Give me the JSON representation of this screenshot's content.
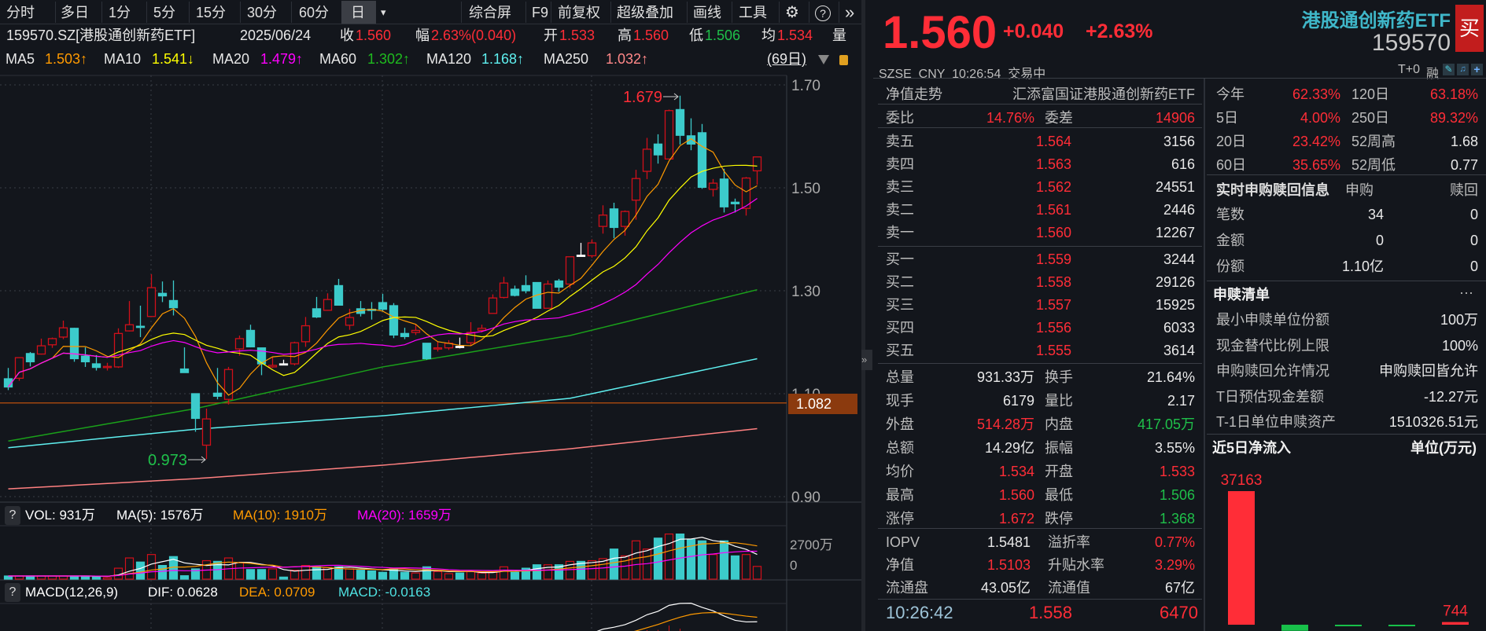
{
  "toolbar": {
    "periods": [
      "分时",
      "多日",
      "1分",
      "5分",
      "15分",
      "30分",
      "60分",
      "日"
    ],
    "dropdown": "▾",
    "tools": [
      "综合屏",
      "F9",
      "前复权",
      "超级叠加",
      "画线",
      "工具"
    ],
    "gear": "⚙",
    "help": "?",
    "expand": "»"
  },
  "info": {
    "code_name": "159570.SZ[港股通创新药ETF]",
    "date": "2025/06/24",
    "close_label": "收",
    "close": "1.560",
    "chg_label": "幅",
    "chg": "2.63%(0.040)",
    "open_label": "开",
    "open": "1.533",
    "high_label": "高",
    "high": "1.560",
    "low_label": "低",
    "low": "1.506",
    "avg_label": "均",
    "avg": "1.534",
    "vol_label": "量"
  },
  "ma": {
    "ma5_label": "MA5",
    "ma5": "1.503↑",
    "ma10_label": "MA10",
    "ma10": "1.541↓",
    "ma20_label": "MA20",
    "ma20": "1.479↑",
    "ma60_label": "MA60",
    "ma60": "1.302↑",
    "ma120_label": "MA120",
    "ma120": "1.168↑",
    "ma250_label": "MA250",
    "ma250": "1.032↑",
    "range": "(69日)"
  },
  "vol_panel": {
    "help": "?",
    "vol": "VOL: 931万",
    "ma5": "MA(5): 1576万",
    "ma10": "MA(10): 1910万",
    "ma20": "MA(20): 1659万",
    "axis_top": "2700万",
    "axis_zero": "0"
  },
  "macd_panel": {
    "help": "?",
    "title": "MACD(12,26,9)",
    "dif": "DIF: 0.0628",
    "dea": "DEA: 0.0709",
    "macd": "MACD: -0.0163"
  },
  "quote": {
    "price": "1.560",
    "change": "+0.040",
    "pct": "+2.63%",
    "name": "港股通创新药ETF",
    "code": "159570",
    "buy": "买",
    "status": "SZSE  CNY  10:26:54  交易中",
    "t0": "T+0",
    "margin": "融"
  },
  "nav": {
    "label": "净值走势",
    "fund": "汇添富国证港股通创新药ETF"
  },
  "commit": {
    "ratio_label": "委比",
    "ratio": "14.76%",
    "diff_label": "委差",
    "diff": "14906"
  },
  "asks": [
    {
      "label": "卖五",
      "price": "1.564",
      "vol": "3156"
    },
    {
      "label": "卖四",
      "price": "1.563",
      "vol": "616"
    },
    {
      "label": "卖三",
      "price": "1.562",
      "vol": "24551"
    },
    {
      "label": "卖二",
      "price": "1.561",
      "vol": "2446"
    },
    {
      "label": "卖一",
      "price": "1.560",
      "vol": "12267"
    }
  ],
  "bids": [
    {
      "label": "买一",
      "price": "1.559",
      "vol": "3244"
    },
    {
      "label": "买二",
      "price": "1.558",
      "vol": "29126"
    },
    {
      "label": "买三",
      "price": "1.557",
      "vol": "15925"
    },
    {
      "label": "买四",
      "price": "1.556",
      "vol": "6033"
    },
    {
      "label": "买五",
      "price": "1.555",
      "vol": "3614"
    }
  ],
  "stats": [
    {
      "l1": "总量",
      "v1": "931.33万",
      "c1": "w",
      "l2": "换手",
      "v2": "21.64%",
      "c2": "w"
    },
    {
      "l1": "现手",
      "v1": "6179",
      "c1": "w",
      "l2": "量比",
      "v2": "2.17",
      "c2": "w"
    },
    {
      "l1": "外盘",
      "v1": "514.28万",
      "c1": "r",
      "l2": "内盘",
      "v2": "417.05万",
      "c2": "g"
    },
    {
      "l1": "总额",
      "v1": "14.29亿",
      "c1": "w",
      "l2": "振幅",
      "v2": "3.55%",
      "c2": "w"
    },
    {
      "l1": "均价",
      "v1": "1.534",
      "c1": "r",
      "l2": "开盘",
      "v2": "1.533",
      "c2": "r"
    },
    {
      "l1": "最高",
      "v1": "1.560",
      "c1": "r",
      "l2": "最低",
      "v2": "1.506",
      "c2": "g"
    },
    {
      "l1": "涨停",
      "v1": "1.672",
      "c1": "r",
      "l2": "跌停",
      "v2": "1.368",
      "c2": "g"
    }
  ],
  "etf_stats": [
    {
      "l1": "IOPV",
      "v1": "1.5481",
      "c1": "w",
      "l2": "溢折率",
      "v2": "0.77%",
      "c2": "r"
    },
    {
      "l1": "净值",
      "v1": "1.5103",
      "c1": "r",
      "l2": "升贴水率",
      "v2": "3.29%",
      "c2": "r"
    },
    {
      "l1": "流通盘",
      "v1": "43.05亿",
      "c1": "w",
      "l2": "流通值",
      "v2": "67亿",
      "c2": "w"
    }
  ],
  "last_trade": {
    "time": "10:26:42",
    "price": "1.558",
    "vol": "6470"
  },
  "perf": [
    {
      "l1": "今年",
      "v1": "62.33%",
      "c1": "r",
      "l2": "120日",
      "v2": "63.18%",
      "c2": "r"
    },
    {
      "l1": "5日",
      "v1": "4.00%",
      "c1": "r",
      "l2": "250日",
      "v2": "89.32%",
      "c2": "r"
    },
    {
      "l1": "20日",
      "v1": "23.42%",
      "c1": "r",
      "l2": "52周高",
      "v2": "1.68",
      "c2": "w"
    },
    {
      "l1": "60日",
      "v1": "35.65%",
      "c1": "r",
      "l2": "52周低",
      "v2": "0.77",
      "c2": "w"
    }
  ],
  "creation": {
    "title": "实时申购赎回信息",
    "col1": "申购",
    "col2": "赎回",
    "rows": [
      {
        "label": "笔数",
        "v1": "34",
        "v2": "0"
      },
      {
        "label": "金额",
        "v1": "0",
        "v2": "0"
      },
      {
        "label": "份额",
        "v1": "1.10亿",
        "v2": "0"
      }
    ]
  },
  "pcf": {
    "title": "申赎清单",
    "more": "···",
    "rows": [
      {
        "label": "最小申赎单位份额",
        "value": "100万"
      },
      {
        "label": "现金替代比例上限",
        "value": "100%"
      },
      {
        "label": "申购赎回允许情况",
        "value": "申购赎回皆允许"
      },
      {
        "label": "T日预估现金差额",
        "value": "-12.27元"
      },
      {
        "label": "T-1日单位申赎资产",
        "value": "1510326.51元"
      }
    ]
  },
  "colors": {
    "up": "#d0101a",
    "down": "#3ccbcb",
    "flat": "#ffffff",
    "ma5": "#ff9a00",
    "ma10": "#ffff00",
    "ma20": "#ff00ff",
    "ma60": "#1aa01a",
    "ma120": "#5ff0f0",
    "ma250": "#ff8080",
    "price_tag": "#8b3a0e"
  },
  "chart_data": [
    {
      "type": "candlestick",
      "title": "159570.SZ 日K",
      "ylim": [
        0.86,
        1.72
      ],
      "yticks": [
        "1.70",
        "1.50",
        "1.30",
        "1.10",
        "0.90"
      ],
      "ytick_values": [
        1.7,
        1.5,
        1.3,
        1.1,
        0.9
      ],
      "current_price_tag": "1.082",
      "current_price_value": 1.082,
      "high_mark": "1.679",
      "high_index": 61,
      "low_mark": "0.973",
      "low_index": 18,
      "ohlc": [
        [
          1.129,
          1.15,
          1.107,
          1.113
        ],
        [
          1.13,
          1.17,
          1.125,
          1.17
        ],
        [
          1.178,
          1.181,
          1.153,
          1.162
        ],
        [
          1.177,
          1.207,
          1.176,
          1.193
        ],
        [
          1.195,
          1.209,
          1.189,
          1.207
        ],
        [
          1.21,
          1.242,
          1.206,
          1.228
        ],
        [
          1.227,
          1.228,
          1.162,
          1.168
        ],
        [
          1.173,
          1.19,
          1.152,
          1.162
        ],
        [
          1.158,
          1.175,
          1.145,
          1.151
        ],
        [
          1.152,
          1.16,
          1.145,
          1.153
        ],
        [
          1.152,
          1.227,
          1.15,
          1.217
        ],
        [
          1.222,
          1.28,
          1.221,
          1.234
        ],
        [
          1.231,
          1.271,
          1.21,
          1.229
        ],
        [
          1.25,
          1.332,
          1.25,
          1.306
        ],
        [
          1.295,
          1.318,
          1.278,
          1.29
        ],
        [
          1.281,
          1.32,
          1.252,
          1.267
        ],
        [
          1.148,
          1.19,
          1.141,
          1.141
        ],
        [
          1.1,
          1.1,
          1.026,
          1.052
        ],
        [
          1.0,
          1.071,
          0.973,
          1.051
        ],
        [
          1.101,
          1.15,
          1.089,
          1.095
        ],
        [
          1.089,
          1.152,
          1.079,
          1.147
        ],
        [
          1.187,
          1.213,
          1.174,
          1.207
        ],
        [
          1.223,
          1.234,
          1.19,
          1.191
        ],
        [
          1.189,
          1.189,
          1.136,
          1.158
        ],
        [
          1.152,
          1.171,
          1.15,
          1.155
        ],
        [
          1.158,
          1.166,
          1.155,
          1.157
        ],
        [
          1.158,
          1.201,
          1.155,
          1.199
        ],
        [
          1.201,
          1.249,
          1.191,
          1.232
        ],
        [
          1.265,
          1.288,
          1.247,
          1.249
        ],
        [
          1.262,
          1.295,
          1.261,
          1.283
        ],
        [
          1.31,
          1.323,
          1.272,
          1.272
        ],
        [
          1.233,
          1.265,
          1.224,
          1.248
        ],
        [
          1.265,
          1.28,
          1.25,
          1.256
        ],
        [
          1.264,
          1.278,
          1.244,
          1.262
        ],
        [
          1.277,
          1.294,
          1.26,
          1.264
        ],
        [
          1.271,
          1.276,
          1.208,
          1.214
        ],
        [
          1.217,
          1.228,
          1.206,
          1.211
        ],
        [
          1.219,
          1.234,
          1.214,
          1.223
        ],
        [
          1.198,
          1.198,
          1.166,
          1.168
        ],
        [
          1.187,
          1.201,
          1.182,
          1.189
        ],
        [
          1.189,
          1.204,
          1.185,
          1.198
        ],
        [
          1.192,
          1.209,
          1.188,
          1.192
        ],
        [
          1.199,
          1.239,
          1.194,
          1.219
        ],
        [
          1.223,
          1.234,
          1.219,
          1.227
        ],
        [
          1.256,
          1.293,
          1.256,
          1.286
        ],
        [
          1.287,
          1.327,
          1.285,
          1.315
        ],
        [
          1.303,
          1.31,
          1.289,
          1.291
        ],
        [
          1.31,
          1.33,
          1.295,
          1.3
        ],
        [
          1.316,
          1.316,
          1.266,
          1.266
        ],
        [
          1.266,
          1.32,
          1.266,
          1.313
        ],
        [
          1.319,
          1.323,
          1.298,
          1.307
        ],
        [
          1.313,
          1.366,
          1.305,
          1.366
        ],
        [
          1.369,
          1.393,
          1.367,
          1.369
        ],
        [
          1.368,
          1.4,
          1.364,
          1.393
        ],
        [
          1.425,
          1.466,
          1.411,
          1.447
        ],
        [
          1.459,
          1.471,
          1.402,
          1.423
        ],
        [
          1.425,
          1.456,
          1.407,
          1.454
        ],
        [
          1.476,
          1.535,
          1.438,
          1.518
        ],
        [
          1.532,
          1.597,
          1.517,
          1.575
        ],
        [
          1.585,
          1.604,
          1.547,
          1.564
        ],
        [
          1.556,
          1.652,
          1.556,
          1.65
        ],
        [
          1.652,
          1.679,
          1.584,
          1.602
        ],
        [
          1.601,
          1.635,
          1.573,
          1.585
        ],
        [
          1.607,
          1.624,
          1.498,
          1.501
        ],
        [
          1.497,
          1.517,
          1.483,
          1.509
        ],
        [
          1.517,
          1.537,
          1.452,
          1.463
        ],
        [
          1.472,
          1.479,
          1.452,
          1.469
        ],
        [
          1.46,
          1.521,
          1.446,
          1.519
        ],
        [
          1.533,
          1.56,
          1.506,
          1.56
        ]
      ],
      "long_ma_anchors": {
        "index": [
          0,
          17,
          34,
          51,
          68
        ],
        "ma60": [
          1.008,
          1.071,
          1.152,
          1.213,
          1.302
        ],
        "ma120": [
          0.995,
          1.031,
          1.057,
          1.091,
          1.168
        ],
        "ma250": [
          0.915,
          0.935,
          0.961,
          0.993,
          1.032
        ]
      }
    },
    {
      "type": "bar",
      "title": "VOL",
      "unit": "万",
      "values": [
        230,
        230,
        230,
        230,
        230,
        230,
        230,
        230,
        200,
        110,
        800,
        1550,
        1250,
        1800,
        1000,
        1650,
        250,
        750,
        1350,
        1300,
        1550,
        1200,
        700,
        700,
        750,
        150,
        650,
        1000,
        900,
        850,
        900,
        750,
        650,
        600,
        500,
        750,
        500,
        450,
        900,
        550,
        400,
        450,
        550,
        450,
        550,
        900,
        500,
        800,
        1050,
        1050,
        1050,
        1300,
        1300,
        1350,
        1500,
        2200,
        1700,
        2800,
        2200,
        3000,
        3300,
        3300,
        2900,
        2800,
        1800,
        2800,
        1700,
        1800,
        931
      ]
    },
    {
      "type": "line",
      "title": "MACD(12,26,9)",
      "series": [
        "DIF",
        "DEA",
        "MACD"
      ]
    },
    {
      "type": "bar",
      "title": "近5日净流入",
      "unit": "单位(万元)",
      "values": [
        37163,
        -1700,
        -200,
        -250,
        744
      ],
      "labels": [
        "37163",
        "",
        "",
        "",
        "744"
      ]
    }
  ]
}
